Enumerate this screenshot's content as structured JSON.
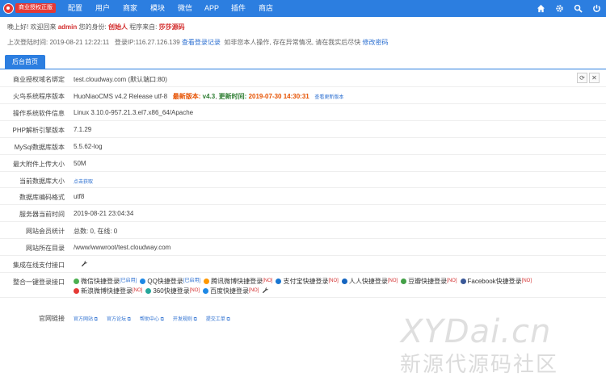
{
  "brand": {
    "logo_text": "商业授权正版"
  },
  "nav": {
    "items": [
      "配置",
      "用户",
      "商家",
      "模块",
      "微信",
      "APP",
      "插件",
      "商店"
    ],
    "icons": [
      "home-icon",
      "gear-icon",
      "search-icon",
      "power-icon"
    ]
  },
  "welcome": {
    "greeting": "晚上好! 欢迎回来",
    "user": "admin",
    "role_label": "您的身份:",
    "role": "创始人",
    "source_label": "程序来自:",
    "source": "莎莎源码"
  },
  "last_login": {
    "label": "上次登陆时间:",
    "time": "2019-08-21 12:22:11",
    "ip": "登录IP:116.27.126.139",
    "view_log": "查看登录记录",
    "warning": "如非您本人操作, 存在异常情况, 请在我实后尽快",
    "change_pwd": "修改密码"
  },
  "tab": {
    "label": "后台首页"
  },
  "rows": {
    "domain": {
      "label": "商业授权域名绑定",
      "value": "test.cloudway.com (默认端口:80)"
    },
    "version": {
      "label": "火鸟系统程序版本",
      "value": "HuoNiaoCMS v4.2 Release utf-8",
      "latest_label": "最新版本:",
      "latest": "v4.3",
      "update_label": "更新时间:",
      "update_time": "2019-07-30 14:30:31",
      "changelog": "查看更新版本"
    },
    "os": {
      "label": "操作系统软件信息",
      "value": "Linux 3.10.0-957.21.3.el7.x86_64/Apache"
    },
    "php": {
      "label": "PHP解析引擎版本",
      "value": "7.1.29"
    },
    "mysql": {
      "label": "MySql数据库版本",
      "value": "5.5.62-log"
    },
    "upload": {
      "label": "最大附件上传大小",
      "value": "50M"
    },
    "dbsize": {
      "label": "当前数据库大小",
      "value": "点击获取"
    },
    "encoding": {
      "label": "数据库编码格式",
      "value": "utf8"
    },
    "servertime": {
      "label": "服务器当前时间",
      "value": "2019-08-21 23:04:34"
    },
    "members": {
      "label": "网站会员统计",
      "value": "总数: 0, 在线: 0"
    },
    "dir": {
      "label": "网站所在目录",
      "value": "/www/wwwroot/test.cloudway.com"
    },
    "payment": {
      "label": "集成在线支付接口"
    },
    "oauth": {
      "label": "整合一键登录接口",
      "items": [
        {
          "name": "微信快捷登录",
          "status": "[已启用]",
          "color": "#4caf50"
        },
        {
          "name": "QQ快捷登录",
          "status": "[已启用]",
          "color": "#1e88e5"
        },
        {
          "name": "腾讯微博快捷登录",
          "status": "[NO]",
          "color": "#ff9800"
        },
        {
          "name": "支付宝快捷登录",
          "status": "[NO]",
          "color": "#1976d2"
        },
        {
          "name": "人人快捷登录",
          "status": "[NO]",
          "color": "#1565c0"
        },
        {
          "name": "豆瓣快捷登录",
          "status": "[NO]",
          "color": "#43a047"
        },
        {
          "name": "Facebook快捷登录",
          "status": "[NO]",
          "color": "#3b5998"
        },
        {
          "name": "新浪微博快捷登录",
          "status": "[NO]",
          "color": "#e53935"
        },
        {
          "name": "360快捷登录",
          "status": "[NO]",
          "color": "#26a69a"
        },
        {
          "name": "百度快捷登录",
          "status": "[NO]",
          "color": "#1e88e5"
        }
      ]
    },
    "official": {
      "label": "官网链接",
      "links": [
        "官方网站",
        "官方论坛",
        "帮助中心",
        "开发规则",
        "提交工单"
      ]
    }
  },
  "watermark": {
    "line1": "XYDai.cn",
    "line2": "新源代源码社区"
  },
  "colors": {
    "accent": "#2c7ee0",
    "red": "#d32f2f",
    "green": "#2e7d32",
    "orange": "#e65100"
  }
}
